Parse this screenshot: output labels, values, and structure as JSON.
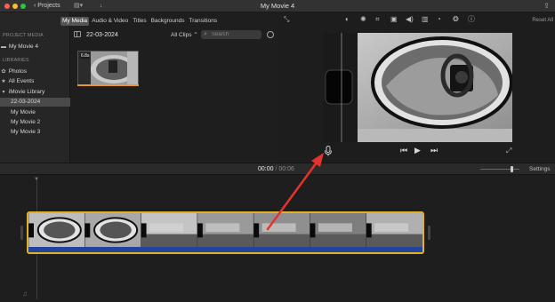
{
  "window": {
    "title": "My Movie 4",
    "projects_label": "Projects",
    "icons": [
      "traffic-light-close",
      "traffic-light-minimize",
      "traffic-light-zoom",
      "chevron-left-icon",
      "layout-icon",
      "download-arrow-icon",
      "share-icon"
    ]
  },
  "sidebar": {
    "project_media_header": "PROJECT MEDIA",
    "project_items": [
      {
        "label": "My Movie 4",
        "icon": "film-icon"
      }
    ],
    "libraries_header": "LIBRARIES",
    "library_items": [
      {
        "label": "Photos",
        "icon": "photos-icon"
      },
      {
        "label": "All Events",
        "icon": "star-icon"
      }
    ],
    "library_name": "iMovie Library",
    "events": [
      {
        "label": "22-03-2024",
        "selected": true
      },
      {
        "label": "My Movie",
        "selected": false
      },
      {
        "label": "My Movie 2",
        "selected": false
      },
      {
        "label": "My Movie 3",
        "selected": false
      }
    ]
  },
  "media_tabs": [
    {
      "label": "My Media",
      "active": true
    },
    {
      "label": "Audio & Video",
      "active": false
    },
    {
      "label": "Titles",
      "active": false
    },
    {
      "label": "Backgrounds",
      "active": false
    },
    {
      "label": "Transitions",
      "active": false
    }
  ],
  "media_bar": {
    "event_title": "22-03-2024",
    "filter_label": "All Clips",
    "search_placeholder": "Search"
  },
  "media_clip": {
    "duration": "6.8s",
    "bar_color": "#e8962e"
  },
  "viewer": {
    "toolbar_icons": [
      "magic-wand-icon",
      "color-balance-icon",
      "color-correction-icon",
      "crop-icon",
      "stabilization-icon",
      "volume-icon",
      "noise-equalizer-icon",
      "speed-icon",
      "clip-filter-icon",
      "info-icon"
    ],
    "reset_label": "Reset All",
    "transport_icons": [
      "voiceover-mic-icon",
      "skip-back-icon",
      "play-icon",
      "skip-forward-icon",
      "fullscreen-icon"
    ]
  },
  "timeline": {
    "current_time": "00:00",
    "separator": "/",
    "total_time": "00:06",
    "settings_label": "Settings",
    "clip_border_color": "#e1b12a",
    "audio_color": "#23449c",
    "frame_count": 7
  },
  "annotation": {
    "arrow_color": "#e5322d"
  }
}
